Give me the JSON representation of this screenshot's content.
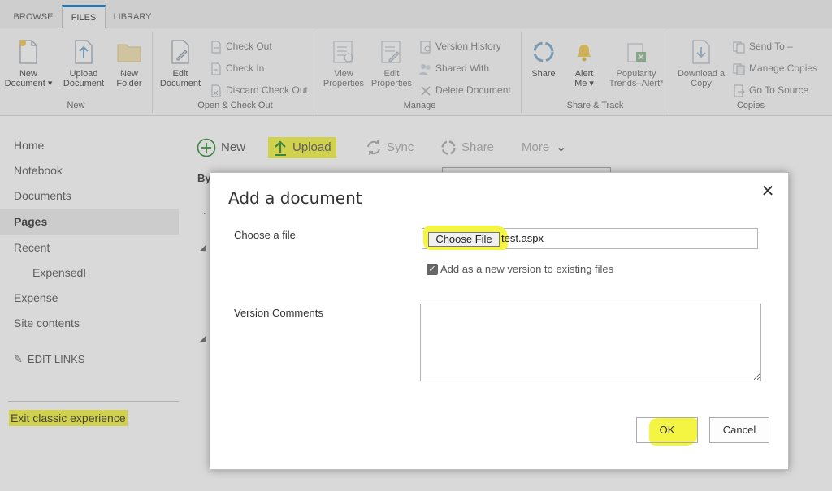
{
  "ribbon": {
    "tabs": [
      "BROWSE",
      "FILES",
      "LIBRARY"
    ],
    "active_tab": "FILES",
    "groups": {
      "new": {
        "label": "New",
        "new_document": [
          "New",
          "Document ▾"
        ],
        "upload_document": [
          "Upload",
          "Document"
        ],
        "new_folder": [
          "New",
          "Folder"
        ]
      },
      "open_checkout": {
        "label": "Open & Check Out",
        "edit_document": [
          "Edit",
          "Document"
        ],
        "check_out": "Check Out",
        "check_in": "Check In",
        "discard_check_out": "Discard Check Out"
      },
      "manage": {
        "label": "Manage",
        "view_properties": [
          "View",
          "Properties"
        ],
        "edit_properties": [
          "Edit",
          "Properties"
        ],
        "version_history": "Version History",
        "shared_with": "Shared With",
        "delete_document": "Delete Document"
      },
      "share_track": {
        "label": "Share & Track",
        "share": "Share",
        "alert_me": [
          "Alert",
          "Me ▾"
        ],
        "popularity": [
          "Popularity",
          "Trends–Alert*"
        ]
      },
      "copies": {
        "label": "Copies",
        "download_copy": [
          "Download a",
          "Copy"
        ],
        "send_to": "Send To –",
        "manage_copies": "Manage Copies",
        "go_to_source": "Go To Source"
      }
    }
  },
  "nav": {
    "items": [
      "Home",
      "Notebook",
      "Documents",
      "Pages",
      "Recent",
      "ExpensedI",
      "Expense",
      "Site contents"
    ],
    "active": "Pages",
    "edit_links": "EDIT LINKS",
    "exit_classic": "Exit classic experience"
  },
  "commandbar": {
    "new": "New",
    "upload": "Upload",
    "sync": "Sync",
    "share": "Share",
    "more": "More"
  },
  "background": {
    "by_label": "By"
  },
  "dialog": {
    "title": "Add a document",
    "close_symbol": "✕",
    "choose_file_label": "Choose a file",
    "choose_file_button": "Choose File",
    "file_name": "test.aspx",
    "add_version_checked": true,
    "add_version_label": "Add as a new version to existing files",
    "version_comments_label": "Version Comments",
    "version_comments_value": "",
    "ok_label": "OK",
    "cancel_label": "Cancel"
  },
  "colors": {
    "highlight": "#f4f442",
    "accent_green": "#2a8a2a",
    "ribbon_bg": "#fafafa",
    "active_tab_border": "#0078d4"
  },
  "icons": {
    "new_document": "new-document-icon",
    "upload_document": "upload-document-icon",
    "new_folder": "folder-icon",
    "edit_document": "edit-document-icon",
    "check_out": "check-out-icon",
    "check_in": "check-in-icon",
    "discard_check_out": "discard-check-out-icon",
    "view_properties": "view-properties-icon",
    "edit_properties": "edit-properties-icon",
    "version_history": "version-history-icon",
    "shared_with": "shared-with-icon",
    "delete_document": "delete-icon",
    "share": "share-icon",
    "alert_me": "bell-icon",
    "popularity": "excel-trends-icon",
    "download_copy": "download-copy-icon",
    "send_to": "send-to-icon",
    "manage_copies": "manage-copies-icon",
    "go_to_source": "go-to-source-icon",
    "new_plus": "plus-circle-icon",
    "upload_arrow": "upload-arrow-icon",
    "sync": "sync-icon",
    "share_cmd": "share-icon",
    "more_chevron": "chevron-down-icon",
    "edit_links_pencil": "pencil-icon",
    "close": "close-icon"
  }
}
